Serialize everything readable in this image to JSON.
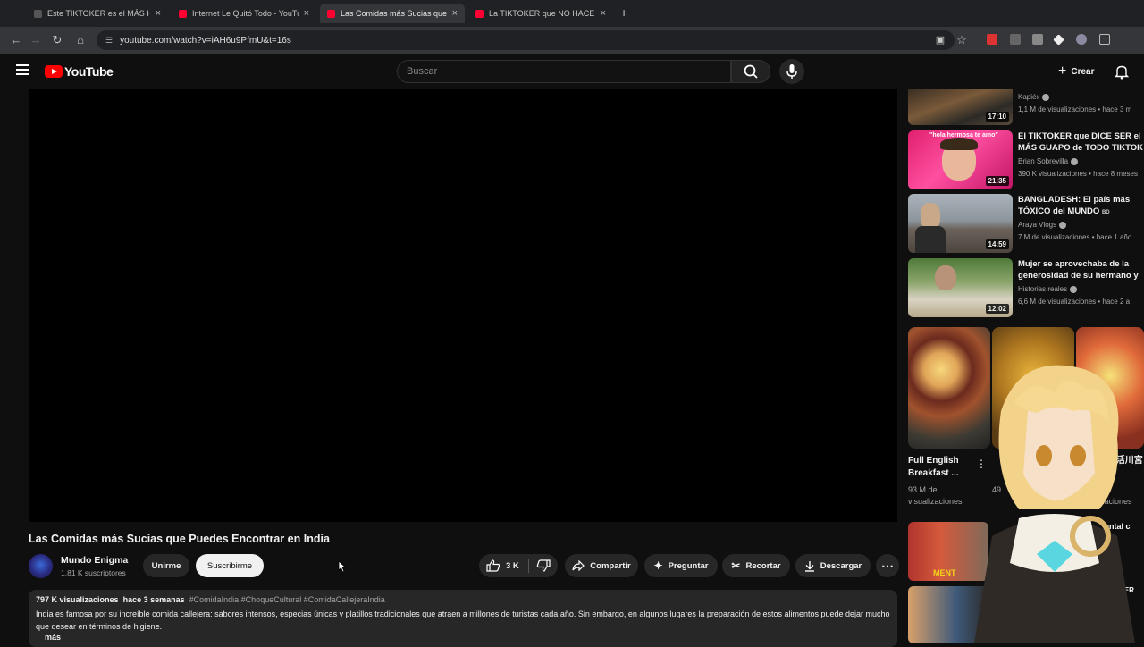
{
  "browser": {
    "tabs": [
      {
        "title": "Este TIKTOKER es el MÁS HERMOSO",
        "close": "×"
      },
      {
        "title": "Internet Le Quitó Todo - YouTube",
        "close": "×"
      },
      {
        "title": "Las Comidas más Sucias que Puedes",
        "close": "×"
      },
      {
        "title": "La TIKTOKER que NO HACE NADA",
        "close": "×"
      }
    ],
    "new_tab": "+",
    "url": "youtube.com/watch?v=iAH6u9PfmU&t=16s"
  },
  "header": {
    "logo_text": "YouTube",
    "search_placeholder": "Buscar",
    "create_label": "Crear"
  },
  "video": {
    "title": "Las Comidas más Sucias que Puedes Encontrar en India",
    "channel": "Mundo Enigma",
    "subscribers": "1,81 K suscriptores",
    "join_label": "Unirme",
    "subscribe_label": "Suscribirme",
    "likes": "3 K",
    "share_label": "Compartir",
    "ask_label": "Preguntar",
    "clip_label": "Recortar",
    "download_label": "Descargar"
  },
  "description": {
    "views": "797 K visualizaciones",
    "date": "hace 3 semanas",
    "tags": "#ComidaIndia #ChoqueCultural #ComidaCallejeraIndia",
    "text": "India es famosa por su increíble comida callejera: sabores intensos, especias únicas y platillos tradicionales que atraen a millones de turistas cada año. Sin embargo, en algunos lugares la preparación de estos alimentos puede dejar mucho que desear en términos de higiene.",
    "more": "más"
  },
  "sidebar": {
    "recs": [
      {
        "title": "",
        "channel": "Kapiéx",
        "meta": "1,1 M de visualizaciones • hace 3 m",
        "duration": "17:10"
      },
      {
        "title": "El TIKTOKER que DICE SER el MÁS GUAPO de TODO TIKTOK",
        "channel": "Brian Sobrevilla",
        "meta": "390 K visualizaciones • hace 8 meses",
        "duration": "21:35",
        "thumb_text": "\"hola hermosa te amo\""
      },
      {
        "title": "BANGLADESH: El país más TÓXICO del MUNDO",
        "title_flag": "BD",
        "channel": "Araya Vlogs",
        "meta": "7 M de visualizaciones • hace 1 año",
        "duration": "14:59"
      },
      {
        "title": "Mujer se aprovechaba de la generosidad de su hermano y",
        "channel": "Historias reales",
        "meta": "6,6 M de visualizaciones • hace 2 a",
        "duration": "12:02"
      }
    ],
    "shorts": [
      {
        "title": "Full English Breakfast ...",
        "meta": "93 M de visualizaciones"
      },
      {
        "title": "",
        "meta": "49"
      },
      {
        "title": "ニメ料理 活川宮崎...",
        "meta": "18 M de visualizaciones"
      }
    ],
    "bottom_label_1": "MENT",
    "bottom_label_2": "RER",
    "bottom_label_3": "ental c"
  },
  "colors": {
    "background": "#0f0f0f",
    "youtube_red": "#ff0000",
    "chip": "#272727"
  }
}
